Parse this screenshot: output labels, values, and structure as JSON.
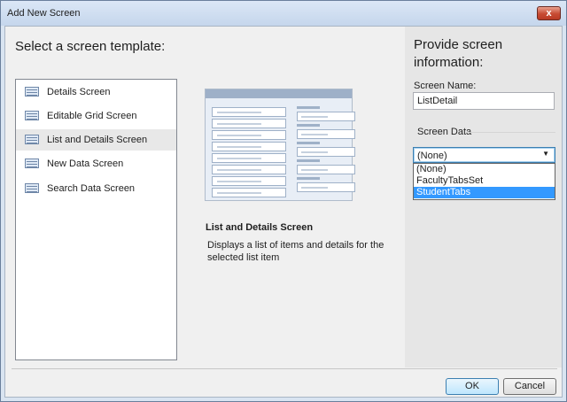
{
  "window": {
    "title": "Add New Screen",
    "close_label": "x"
  },
  "left": {
    "heading": "Select a screen template:",
    "templates": [
      {
        "label": "Details Screen"
      },
      {
        "label": "Editable Grid Screen"
      },
      {
        "label": "List and Details Screen"
      },
      {
        "label": "New Data Screen"
      },
      {
        "label": "Search Data Screen"
      }
    ],
    "selected_index": 2,
    "description": {
      "title": "List and Details Screen",
      "text": "Displays a list of items and details for the selected list item"
    }
  },
  "right": {
    "heading_line1": "Provide screen",
    "heading_line2": "information:",
    "screen_name_label": "Screen Name:",
    "screen_name_value": "ListDetail",
    "screen_data_label": "Screen Data",
    "screen_data_selected": "(None)",
    "options": [
      "(None)",
      "FacultyTabsSet",
      "StudentTabs"
    ],
    "highlighted_option_index": 2
  },
  "footer": {
    "ok_label": "OK",
    "cancel_label": "Cancel"
  },
  "icons": {
    "template_icon": "screen-template-icon",
    "combo_arrow": "chevron-down-icon",
    "close": "close-icon"
  },
  "colors": {
    "selection_highlight": "#3399ff",
    "titlebar": "#c5d6ec",
    "close_button": "#c74b33"
  }
}
